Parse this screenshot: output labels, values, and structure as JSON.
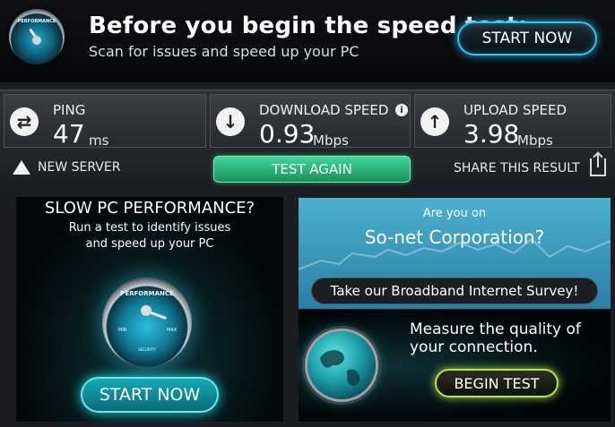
{
  "banner": {
    "title": "Before you begin the speed test:",
    "subtitle": "Scan for issues and speed up your PC",
    "start_label": "START NOW",
    "gauge_label": "PERFORMANCE"
  },
  "results": {
    "ping": {
      "label": "PING",
      "value": "47",
      "unit": "ms"
    },
    "download": {
      "label": "DOWNLOAD SPEED",
      "value": "0.93",
      "unit": "Mbps"
    },
    "upload": {
      "label": "UPLOAD SPEED",
      "value": "3.98",
      "unit": "Mbps"
    },
    "info_icon_glyph": "i"
  },
  "actions": {
    "new_server": "NEW SERVER",
    "test_again": "TEST AGAIN",
    "share": "SHARE THIS RESULT"
  },
  "ad_left": {
    "title": "SLOW PC PERFORMANCE?",
    "text_line1": "Run a test to identify issues",
    "text_line2": "and speed up your PC",
    "gauge_top": "PERFORMANCE",
    "gauge_min": "MIN",
    "gauge_max": "MAX",
    "gauge_bottom": "SECURITY",
    "start_label": "START NOW"
  },
  "survey": {
    "question": "Are you on",
    "company": "So-net Corporation?",
    "button": "Take our Broadband Internet Survey!"
  },
  "measure": {
    "line1": "Measure the quality of",
    "line2": "your connection.",
    "button": "BEGIN TEST"
  },
  "colors": {
    "test_again": "#2fb37a",
    "start_glow": "#38c3ef",
    "begin_glow": "#b8e05a",
    "survey_bg": "#3e9cc2"
  }
}
